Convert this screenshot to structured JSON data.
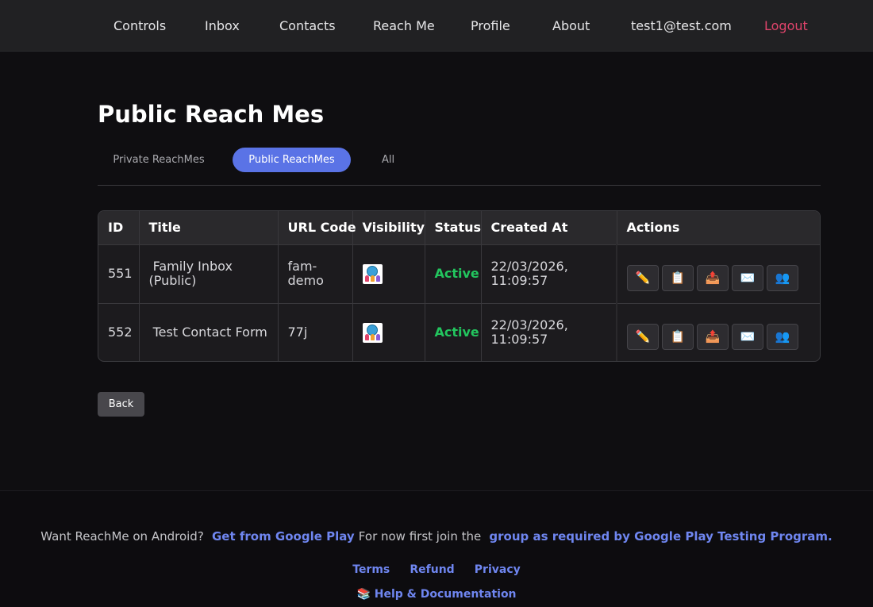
{
  "nav": {
    "controls": "Controls",
    "inbox": "Inbox",
    "contacts": "Contacts",
    "reach_me": "Reach Me",
    "profile": "Profile",
    "about": "About",
    "user_email": "test1@test.com",
    "logout": "Logout"
  },
  "page": {
    "title": "Public Reach Mes",
    "tabs": [
      {
        "label": "Private ReachMes",
        "active": false
      },
      {
        "label": "Public ReachMes",
        "active": true
      },
      {
        "label": "All",
        "active": false
      }
    ]
  },
  "table": {
    "headers": [
      "ID",
      "Title",
      "URL Code",
      "Visibility",
      "Status",
      "Created At",
      "Actions"
    ],
    "rows": [
      {
        "id": "551",
        "title": " Family Inbox (Public)",
        "url_code": "fam-demo",
        "visibility_icon": "globe-people-icon",
        "status": "Active",
        "created_at": "22/03/2026, 11:09:57"
      },
      {
        "id": "552",
        "title": " Test Contact Form",
        "url_code": "77j",
        "visibility_icon": "globe-people-icon",
        "status": "Active",
        "created_at": "22/03/2026, 11:09:57"
      }
    ],
    "actions": [
      {
        "name": "edit",
        "glyph": "✏️"
      },
      {
        "name": "copy",
        "glyph": "📋"
      },
      {
        "name": "export",
        "glyph": "📤"
      },
      {
        "name": "email",
        "glyph": "✉️"
      },
      {
        "name": "contacts",
        "glyph": "👥"
      }
    ]
  },
  "back_label": "Back",
  "footer": {
    "android_text": "Want ReachMe on Android?",
    "google_play_link": "Get from Google Play",
    "join_text": "For now first join the",
    "group_link": "group as required by Google Play Testing Program.",
    "terms": "Terms",
    "refund": "Refund",
    "privacy": "Privacy",
    "help_icon": "📚",
    "help": "Help & Documentation"
  },
  "colors": {
    "accent": "#5a73e6",
    "link": "#6f86f0",
    "logout": "#e0446b",
    "active_status": "#22c55e",
    "background": "#0f0e11"
  }
}
